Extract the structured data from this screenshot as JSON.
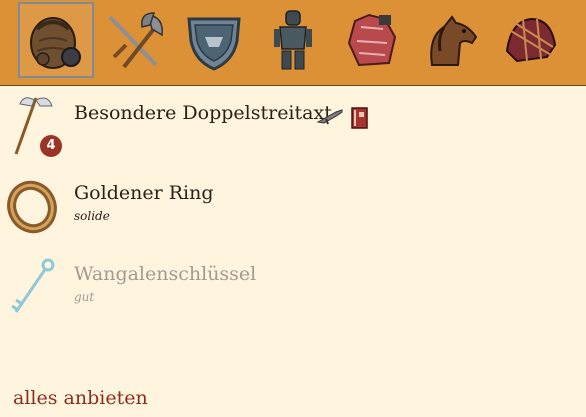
{
  "tabs": [
    {
      "icon": "bag-icon",
      "active": true
    },
    {
      "icon": "weapons-icon",
      "active": false
    },
    {
      "icon": "shield-icon",
      "active": false
    },
    {
      "icon": "armor-icon",
      "active": false
    },
    {
      "icon": "clothing-icon",
      "active": false
    },
    {
      "icon": "horse-icon",
      "active": false
    },
    {
      "icon": "horse-barding-icon",
      "active": false
    }
  ],
  "items": [
    {
      "name": "Besondere Doppelstreitaxt",
      "quality": "",
      "count": "4",
      "icon": "double-axe-icon",
      "attr_icons": [
        "gun-icon",
        "book-icon"
      ],
      "disabled": false
    },
    {
      "name": "Goldener Ring",
      "quality": "solide",
      "icon": "ring-icon",
      "disabled": false
    },
    {
      "name": "Wangalenschlüssel",
      "quality": "gut",
      "icon": "key-icon",
      "disabled": true
    }
  ],
  "footer": {
    "offer_all": "alles anbieten"
  },
  "colors": {
    "tabbar": "#dc9137",
    "background": "#fff4de",
    "link": "#8b2e20",
    "badge": "#9b3326"
  }
}
